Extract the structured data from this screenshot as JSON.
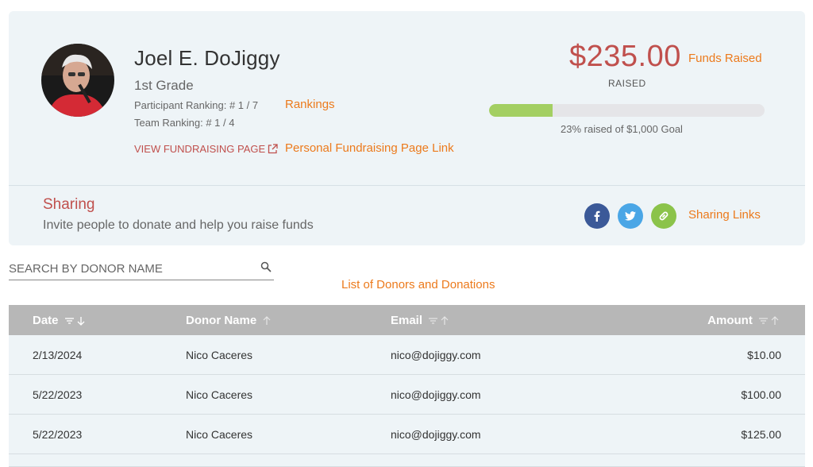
{
  "participant": {
    "name": "Joel E. DoJiggy",
    "grade": "1st Grade",
    "participant_ranking": "Participant Ranking: # 1 / 7",
    "team_ranking": "Team Ranking: # 1 / 4",
    "view_page_label": "VIEW FUNDRAISING PAGE"
  },
  "funds": {
    "amount": "$235.00",
    "raised_label": "RAISED",
    "progress_fraction": 0.23,
    "goal_text": "23% raised of $1,000 Goal"
  },
  "sharing": {
    "title": "Sharing",
    "subtitle": "Invite people to donate and help you raise funds",
    "buttons": [
      {
        "icon": "facebook-icon",
        "glyph": "f"
      },
      {
        "icon": "twitter-icon",
        "glyph": "t"
      },
      {
        "icon": "link-icon",
        "glyph": "link"
      }
    ]
  },
  "annotations": {
    "funds_raised": "Funds Raised",
    "rankings": "Rankings",
    "personal_page_link": "Personal Fundraising Page Link",
    "sharing_links": "Sharing Links",
    "donor_list": "List of Donors and Donations"
  },
  "search": {
    "placeholder": "SEARCH BY DONOR NAME"
  },
  "table": {
    "columns": [
      "Date",
      "Donor Name",
      "Email",
      "Amount"
    ],
    "rows": [
      [
        "2/13/2024",
        "Nico Caceres",
        "nico@dojiggy.com",
        "$10.00"
      ],
      [
        "5/22/2023",
        "Nico Caceres",
        "nico@dojiggy.com",
        "$100.00"
      ],
      [
        "5/22/2023",
        "Nico Caceres",
        "nico@dojiggy.com",
        "$125.00"
      ]
    ]
  },
  "colors": {
    "accent_red": "#c0504d",
    "annotation_orange": "#ec7a1c",
    "progress_green": "#a3cf62",
    "facebook_blue": "#3b5998",
    "twitter_blue": "#4aa6e6",
    "link_green": "#8bc34a"
  }
}
